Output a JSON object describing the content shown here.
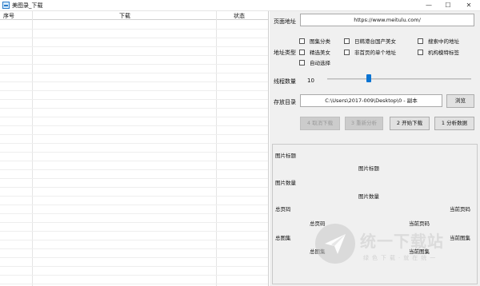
{
  "window": {
    "title": "美图录_下载",
    "controls": {
      "minimize": "—",
      "maximize": "☐",
      "close": "✕"
    }
  },
  "list": {
    "columns": [
      "序号",
      "下载",
      "状态"
    ],
    "rows": []
  },
  "form": {
    "page_url_label": "页面地址",
    "page_url_value": "https://www.meitulu.com/",
    "address_type_label": "地址类型",
    "checkboxes": [
      {
        "label": "图集分类",
        "checked": false
      },
      {
        "label": "日韩港台国产美女",
        "checked": false
      },
      {
        "label": "搜索中的地址",
        "checked": false
      },
      {
        "label": "精选美女",
        "checked": false
      },
      {
        "label": "非首页的单个地址",
        "checked": false
      },
      {
        "label": "机构模特标签",
        "checked": false
      },
      {
        "label": "自动选择",
        "checked": false
      }
    ],
    "threads_label": "线程数量",
    "threads_value": "10",
    "threads_fraction": 0.29,
    "save_dir_label": "存放目录",
    "save_dir_value": "C:\\Users\\2017-009\\Desktop\\0 - 副本",
    "browse_button": "浏览"
  },
  "actions": {
    "cancel": "4 取消下载",
    "reanalyze": "3 重新分析",
    "start": "2 开始下载",
    "analyze": "1 分析数据"
  },
  "info": {
    "pic_title_label": "图片标题",
    "pic_title_value": "图片标题",
    "pic_count_label": "图片数量",
    "pic_count_value": "图片数量",
    "total_pages_label": "总页码",
    "current_page_label": "当前页码",
    "total_pages_value": "总页码",
    "current_page_value": "当前页码",
    "total_sets_label": "总图集",
    "current_sets_label": "当前图集",
    "total_sets_value": "总图集",
    "current_sets_value": "当前图集"
  },
  "watermark": {
    "big": "统一下载站",
    "small": "绿色下载·就在统一"
  },
  "colors": {
    "slider_thumb": "#0a74d3",
    "panel_bg": "#f0f0f0"
  }
}
